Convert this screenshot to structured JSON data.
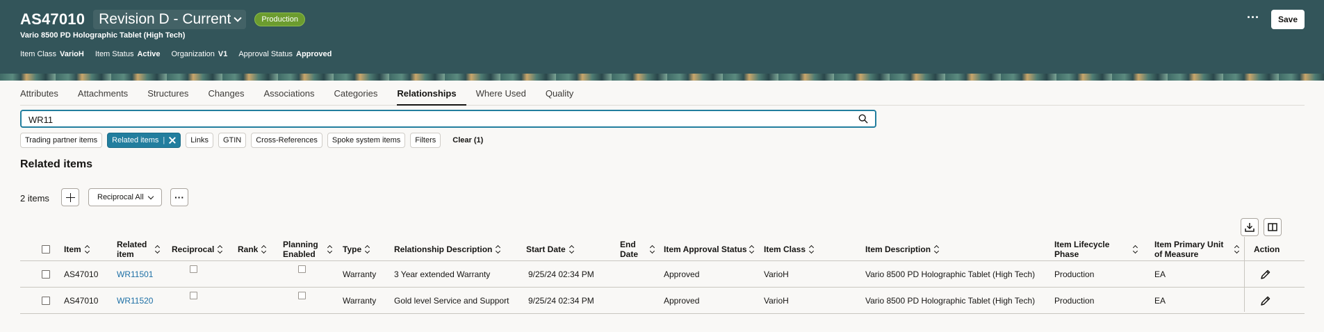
{
  "header": {
    "item_number": "AS47010",
    "revision": "Revision D - Current",
    "lifecycle_badge": "Production",
    "description": "Vario 8500 PD Holographic Tablet (High Tech)",
    "meta": [
      {
        "label": "Item Class",
        "value": "VarioH"
      },
      {
        "label": "Item Status",
        "value": "Active"
      },
      {
        "label": "Organization",
        "value": "V1"
      },
      {
        "label": "Approval Status",
        "value": "Approved"
      }
    ],
    "save_label": "Save",
    "more_label": "···"
  },
  "tabs": [
    {
      "label": "Attributes"
    },
    {
      "label": "Attachments"
    },
    {
      "label": "Structures"
    },
    {
      "label": "Changes"
    },
    {
      "label": "Associations"
    },
    {
      "label": "Categories"
    },
    {
      "label": "Relationships"
    },
    {
      "label": "Where Used"
    },
    {
      "label": "Quality"
    }
  ],
  "active_tab": "Relationships",
  "search": {
    "value": "WR11"
  },
  "filters": {
    "trading_partner": "Trading partner items",
    "related_items": "Related items",
    "links": "Links",
    "gtin": "GTIN",
    "cross_references": "Cross-References",
    "spoke_system": "Spoke system items",
    "filters": "Filters",
    "clear": "Clear (1)"
  },
  "section_title": "Related items",
  "toolbar": {
    "count": "2 items",
    "reciprocal_select": "Reciprocal All",
    "overflow": "···"
  },
  "table": {
    "headers": {
      "item": "Item",
      "related_item": "Related item",
      "reciprocal": "Reciprocal",
      "rank": "Rank",
      "planning_enabled": "Planning Enabled",
      "type": "Type",
      "relationship_description": "Relationship Description",
      "start_date": "Start Date",
      "end_date": "End Date",
      "item_approval_status": "Item Approval Status",
      "item_class": "Item Class",
      "item_description": "Item Description",
      "item_lifecycle_phase": "Item Lifecycle Phase",
      "item_primary_uom": "Item Primary Unit of Measure",
      "action": "Action"
    },
    "rows": [
      {
        "item": "AS47010",
        "related_item": "WR11501",
        "reciprocal": false,
        "rank": "",
        "planning_enabled": false,
        "type": "Warranty",
        "relationship_description": "3 Year extended Warranty",
        "start_date": "9/25/24 02:34 PM",
        "end_date": "",
        "item_approval_status": "Approved",
        "item_class": "VarioH",
        "item_description": "Vario 8500 PD Holographic Tablet (High Tech)",
        "item_lifecycle_phase": "Production",
        "item_primary_uom": "EA"
      },
      {
        "item": "AS47010",
        "related_item": "WR11520",
        "reciprocal": false,
        "rank": "",
        "planning_enabled": false,
        "type": "Warranty",
        "relationship_description": "Gold level Service and Support",
        "start_date": "9/25/24 02:34 PM",
        "end_date": "",
        "item_approval_status": "Approved",
        "item_class": "VarioH",
        "item_description": "Vario 8500 PD Holographic Tablet (High Tech)",
        "item_lifecycle_phase": "Production",
        "item_primary_uom": "EA"
      }
    ]
  },
  "colors": {
    "header_bg": "#33555a",
    "badge_green": "#6c9c2f",
    "accent_blue": "#227e9e",
    "link_blue": "#1d6fa5"
  }
}
